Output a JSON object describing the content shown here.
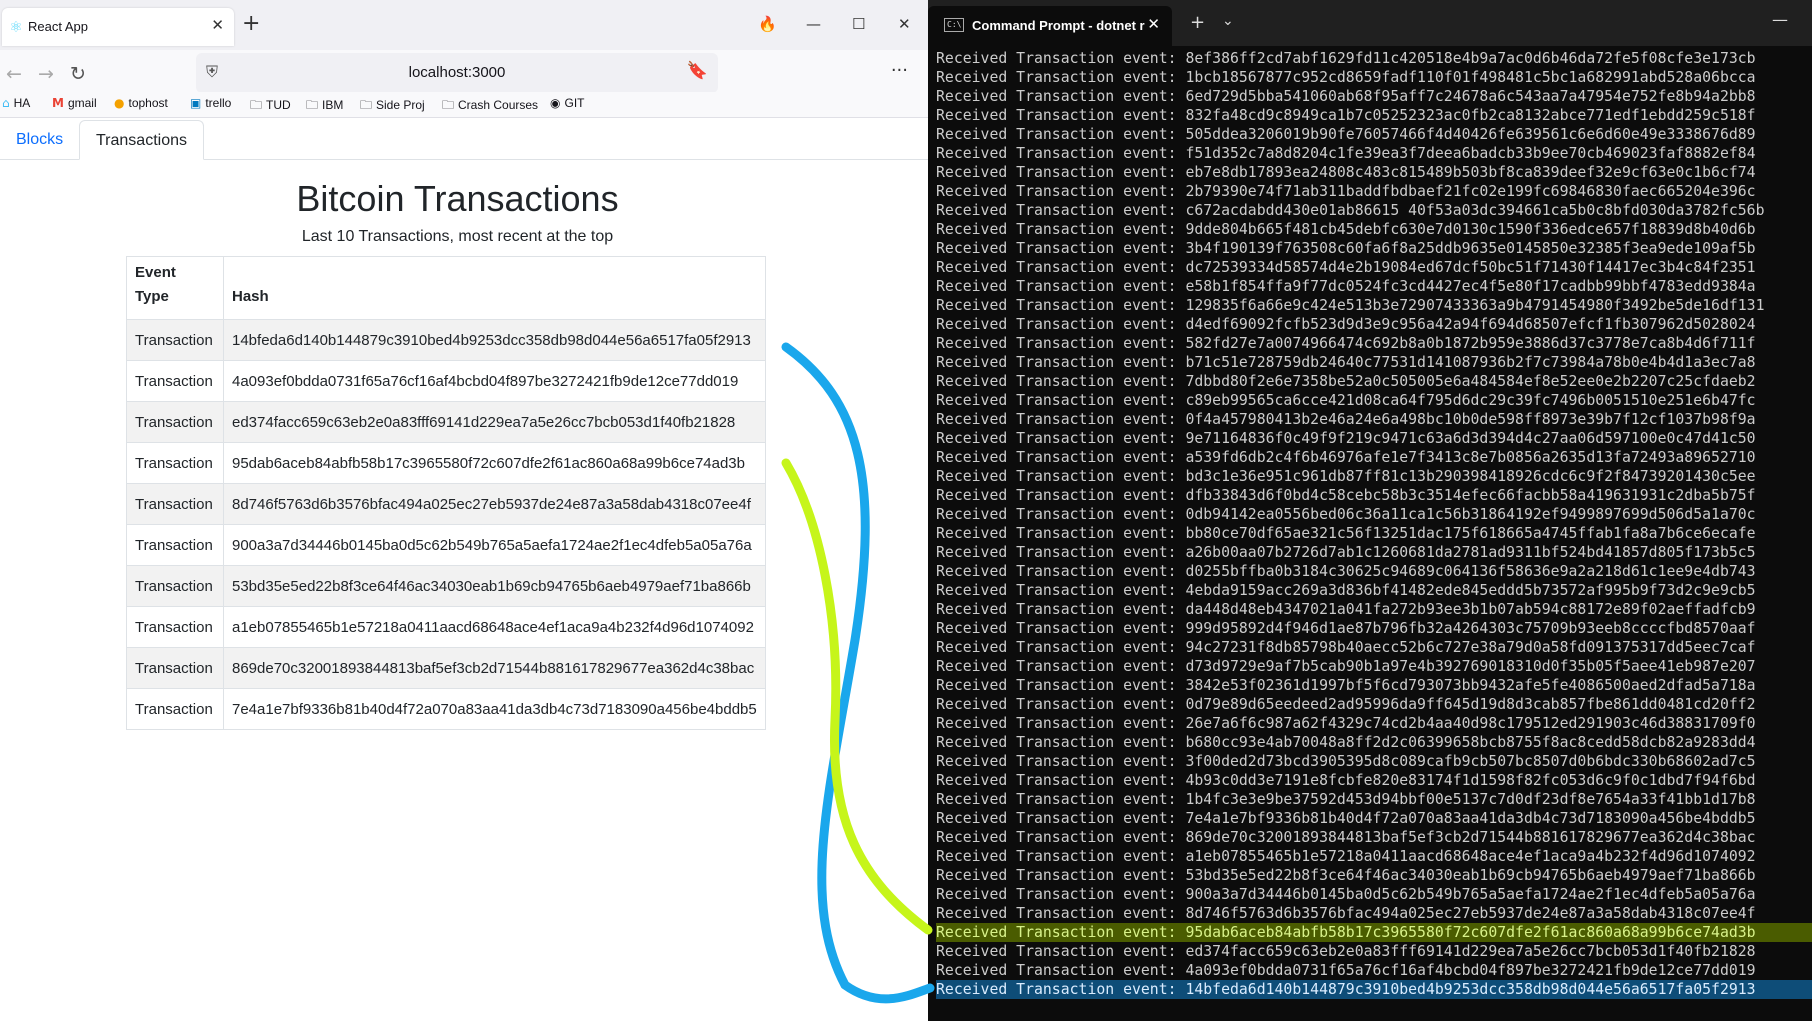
{
  "browser": {
    "tab_title": "React App",
    "tab_favicon": "react-icon",
    "url": "localhost:3000",
    "bookmarks": [
      {
        "label": "HA",
        "icon": "home-assistant-icon"
      },
      {
        "label": "gmail",
        "icon": "gmail-icon"
      },
      {
        "label": "tophost",
        "icon": "tophost-icon"
      },
      {
        "label": "trello",
        "icon": "trello-icon"
      },
      {
        "label": "TUD",
        "icon": "folder-icon"
      },
      {
        "label": "IBM",
        "icon": "folder-icon"
      },
      {
        "label": "Side Proj",
        "icon": "folder-icon"
      },
      {
        "label": "Crash Courses",
        "icon": "folder-icon"
      },
      {
        "label": "GIT",
        "icon": "github-icon"
      }
    ]
  },
  "app": {
    "tabs": [
      {
        "label": "Blocks",
        "active": false
      },
      {
        "label": "Transactions",
        "active": true
      }
    ],
    "title": "Bitcoin Transactions",
    "subtitle": "Last 10 Transactions, most recent at the top",
    "table": {
      "headers": [
        "Event Type",
        "Hash"
      ],
      "rows": [
        [
          "Transaction",
          "14bfeda6d140b144879c3910bed4b9253dcc358db98d044e56a6517fa05f2913"
        ],
        [
          "Transaction",
          "4a093ef0bdda0731f65a76cf16af4bcbd04f897be3272421fb9de12ce77dd019"
        ],
        [
          "Transaction",
          "ed374facc659c63eb2e0a83fff69141d229ea7a5e26cc7bcb053d1f40fb21828"
        ],
        [
          "Transaction",
          "95dab6aceb84abfb58b17c3965580f72c607dfe2f61ac860a68a99b6ce74ad3b"
        ],
        [
          "Transaction",
          "8d746f5763d6b3576bfac494a025ec27eb5937de24e87a3a58dab4318c07ee4f"
        ],
        [
          "Transaction",
          "900a3a7d34446b0145ba0d5c62b549b765a5aefa1724ae2f1ec4dfeb5a05a76a"
        ],
        [
          "Transaction",
          "53bd35e5ed22b8f3ce64f46ac34030eab1b69cb94765b6aeb4979aef71ba866b"
        ],
        [
          "Transaction",
          "a1eb07855465b1e57218a0411aacd68648ace4ef1aca9a4b232f4d96d1074092"
        ],
        [
          "Transaction",
          "869de70c32001893844813baf5ef3cb2d71544b881617829677ea362d4c38bac"
        ],
        [
          "Transaction",
          "7e4a1e7bf9336b81b40d4f72a070a83aa41da3db4c73d7183090a456be4bddb5"
        ]
      ]
    }
  },
  "terminal": {
    "tab_title": "Command Prompt - dotnet  r",
    "prefix": "Received Transaction event: ",
    "lines": [
      "8ef386ff2cd7abf1629fd11c420518e4b9a7ac0d6b46da72fe5f08cfe3e173cb",
      "1bcb18567877c952cd8659fadf110f01f498481c5bc1a682991abd528a06bcca",
      "6ed729d5bba541060ab68f95aff7c24678a6c543aa7a47954e752fe8b94a2bb8",
      "832fa48cd9c8949ca1b7c05252323ac0fb2ca8132abce771edf1ebdd259c518f",
      "505ddea3206019b90fe76057466f4d40426fe639561c6e6d60e49e3338676d89",
      "f51d352c7a8d8204c1fe39ea3f7deea6badcb33b9ee70cb469023faf8882ef84",
      "eb7e8db17893ea24808c483c815489b503bf8ca839deef32e9cf63e0c1b6cf74",
      "2b79390e74f71ab311baddfbdbaef21fc02e199fc69846830faec665204e396c",
      "c672acdabdd430e01ab86615 40f53a03dc394661ca5b0c8bfd030da3782fc56b",
      "9dde804b665f481cb45debfc630e7d0130c1590f336edce657f18839d8b40d6b",
      "3b4f190139f763508c60fa6f8a25ddb9635e0145850e32385f3ea9ede109af5b",
      "dc72539334d58574d4e2b19084ed67dcf50bc51f71430f14417ec3b4c84f2351",
      "e58b1f854ffa9f77dc0524fc3cd4427ec4f5e80f17cadbb99bbf4783edd9384a",
      "129835f6a66e9c424e513b3e72907433363a9b4791454980f3492be5de16df131",
      "d4edf69092fcfb523d9d3e9c956a42a94f694d68507efcf1fb307962d5028024",
      "582fd27e7a0074966474c692b8a0b1872b959e3886d37c3778e7ca8b4d6f711f",
      "b71c51e728759db24640c77531d141087936b2f7c73984a78b0e4b4d1a3ec7a8",
      "7dbbd80f2e6e7358be52a0c505005e6a484584ef8e52ee0e2b2207c25cfdaeb2",
      "c89eb99565ca6cce421d08ca64f795d6dc29c39fc7496b0051510e251e6b47fc",
      "0f4a457980413b2e46a24e6a498bc10b0de598ff8973e39b7f12cf1037b98f9a",
      "9e71164836f0c49f9f219c9471c63a6d3d394d4c27aa06d597100e0c47d41c50",
      "a539fd6db2c4f6b46976afe1e7f3413c8e7b0856a2635d13fa72493a89652710",
      "bd3c1e36e951c961db87ff81c13b290398418926cdc6c9f2f84739201430c5ee",
      "dfb33843d6f0bd4c58cebc58b3c3514efec66facbb58a419631931c2dba5b75f",
      "0db94142ea0556bed06c36a11ca1c56b31864192ef9499897699d506d5a1a70c",
      "bb80ce70df65ae321c56f13251dac175f618665a4745ffab1fa8a7b6ce6ecafe",
      "a26b00aa07b2726d7ab1c1260681da2781ad9311bf524bd41857d805f173b5c5",
      "d0255bffba0b3184c30625c94689c064136f58636e9a2a218d61c1ee9e4db743",
      "4ebda9159acc269a3d836bf41482ede845eddd5b73572af995b9f73d2c9e9cb5",
      "da448d48eb4347021a041fa272b93ee3b1b07ab594c88172e89f02aeffadfcb9",
      "999d95892d4f946d1ae87b796fb32a4264303c75709b93eeb8ccccfbd8570aaf",
      "94c27231f8db85798b40aecc52b6c727e38a79d0a58fd091375317dd5eec7caf",
      "d73d9729e9af7b5cab90b1a97e4b392769018310d0f35b05f5aee41eb987e207",
      "3842e53f02361d1997bf5f6cd793073bb9432afe5fe4086500aed2dfad5a718a",
      "0d79e89d65eedeed2ad95996da9ff645d19d8d3cab857fbe861dd0481cd20ff2",
      "26e7a6f6c987a62f4329c74cd2b4aa40d98c179512ed291903c46d38831709f0",
      "b680cc93e4ab70048a8ff2d2c06399658bcb8755f8ac8cedd58dcb82a9283dd4",
      "3f00ded2d73bcd3905395d8c089cafb9cb507bc8507d0b6bdc330b68602ad7c5",
      "4b93c0dd3e7191e8fcbfe820e83174f1d1598f82fc053d6c9f0c1dbd7f94f6bd",
      "1b4fc3e3e9be37592d453d94bbf00e5137c7d0df23df8e7654a33f41bb1d17b8",
      "7e4a1e7bf9336b81b40d4f72a070a83aa41da3db4c73d7183090a456be4bddb5",
      "869de70c32001893844813baf5ef3cb2d71544b881617829677ea362d4c38bac",
      "a1eb07855465b1e57218a0411aacd68648ace4ef1aca9a4b232f4d96d1074092",
      "53bd35e5ed22b8f3ce64f46ac34030eab1b69cb94765b6aeb4979aef71ba866b",
      "900a3a7d34446b0145ba0d5c62b549b765a5aefa1724ae2f1ec4dfeb5a05a76a",
      "8d746f5763d6b3576bfac494a025ec27eb5937de24e87a3a58dab4318c07ee4f",
      "95dab6aceb84abfb58b17c3965580f72c607dfe2f61ac860a68a99b6ce74ad3b",
      "ed374facc659c63eb2e0a83fff69141d229ea7a5e26cc7bcb053d1f40fb21828",
      "4a093ef0bdda0731f65a76cf16af4bcbd04f897be3272421fb9de12ce77dd019",
      "14bfeda6d140b144879c3910bed4b9253dcc358db98d044e56a6517fa05f2913"
    ],
    "highlight_green_index": 46,
    "highlight_blue_index": 49
  },
  "annotation_colors": {
    "blue": "#1aa7ec",
    "green": "#c6f51a"
  }
}
